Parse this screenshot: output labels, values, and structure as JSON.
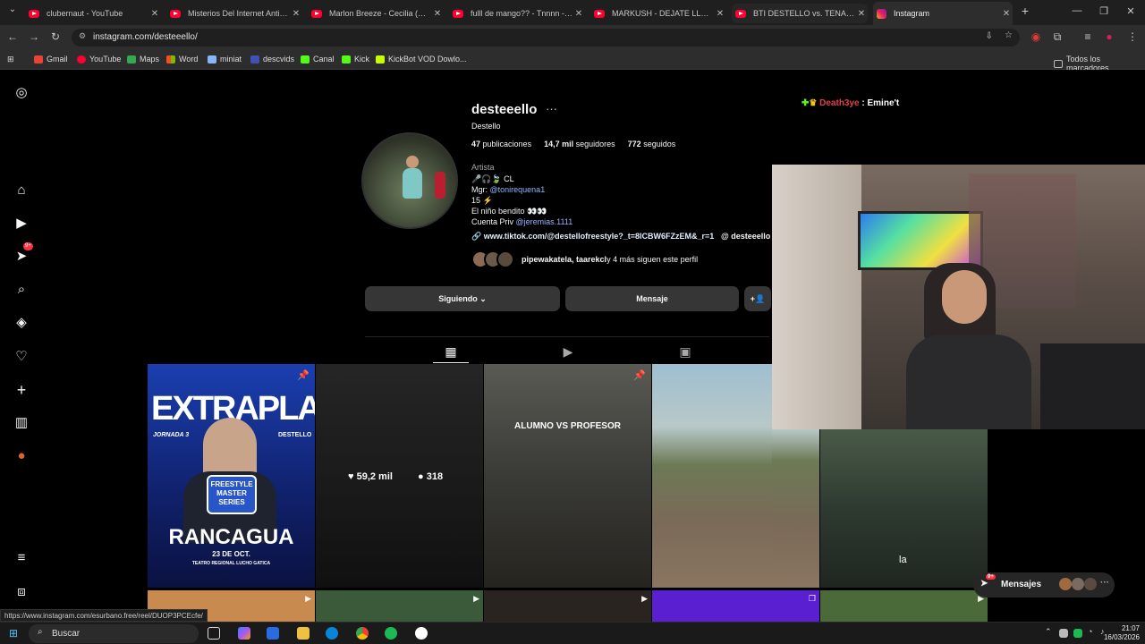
{
  "browser": {
    "tabs": [
      {
        "label": "clubernaut - YouTube",
        "type": "youtube"
      },
      {
        "label": "Misterios Del Internet Antiguo",
        "type": "youtube"
      },
      {
        "label": "Marlon Breeze - Cecilia (Official",
        "type": "youtube"
      },
      {
        "label": "fulll de mango?? - Tnnnn - You",
        "type": "youtube"
      },
      {
        "label": "MARKUSH - DEJATE LLEVAR (V",
        "type": "youtube"
      },
      {
        "label": "BTI DESTELLO vs. TENAZ KAITO",
        "type": "youtube"
      },
      {
        "label": "Instagram",
        "type": "instagram",
        "active": true
      }
    ],
    "url": "instagram.com/desteeello/",
    "bookmarks": [
      "Gmail",
      "YouTube",
      "Maps",
      "Word",
      "miniat",
      "descvids",
      "Canal",
      "Kick",
      "KickBot VOD Dowlo..."
    ],
    "all_bookmarks": "Todos los marcadores",
    "status_url": "https://www.instagram.com/esurbano.free/reel/DUOP3PCEcfe/"
  },
  "profile": {
    "username": "desteeello",
    "more": "···",
    "full_name": "Destello",
    "stats": {
      "posts": "47",
      "posts_label": "publicaciones",
      "followers": "14,7 mil",
      "followers_label": "seguidores",
      "following": "772",
      "following_label": "seguidos"
    },
    "category": "Artista",
    "bio_lines": [
      "🎤🎧🍃 CL",
      "Mgr: ",
      "15 ⚡",
      "El niño bendito 👀👀",
      "Cuenta Priv "
    ],
    "mgr_handle": "@tonirequena1",
    "priv_handle": "@jeremias.1111",
    "link": "www.tiktok.com/@destellofreestyle?_t=8lCBW6FZzEM&_r=1",
    "threads": "desteeello",
    "followed_by": "pipewakatela, taarekcl",
    "followed_by_more": " y 4 más siguen este perfil",
    "buttons": {
      "follow": "Siguiendo ⌄",
      "message": "Mensaje",
      "add": "+👤"
    }
  },
  "posts": [
    {
      "title": "EXTRAPLAYER",
      "sub1": "JORNADA 3",
      "sub2": "DESTELLO",
      "badge": "FREESTYLE MASTER SERIES",
      "city": "RANCAGUA",
      "date": "23 DE OCT.",
      "venue": "TEATRO REGIONAL LUCHO GATICA"
    },
    {
      "likes": "59,2 mil",
      "comments": "318"
    },
    {
      "title": "ALUMNO VS PROFESOR"
    },
    {},
    {
      "caption": "la"
    }
  ],
  "overlay": {
    "chat_user": "Death3ye",
    "chat_sep": " : ",
    "chat_text": "Emine't"
  },
  "messages": {
    "label": "Mensajes",
    "count": "9+"
  },
  "notif_count": "9+",
  "taskbar": {
    "search": "Buscar",
    "time": "21:07",
    "date": "16/03/2026"
  },
  "colors": {
    "accent": "#0095f6",
    "link": "#e0f1ff",
    "chat_user": "#e0424b"
  }
}
